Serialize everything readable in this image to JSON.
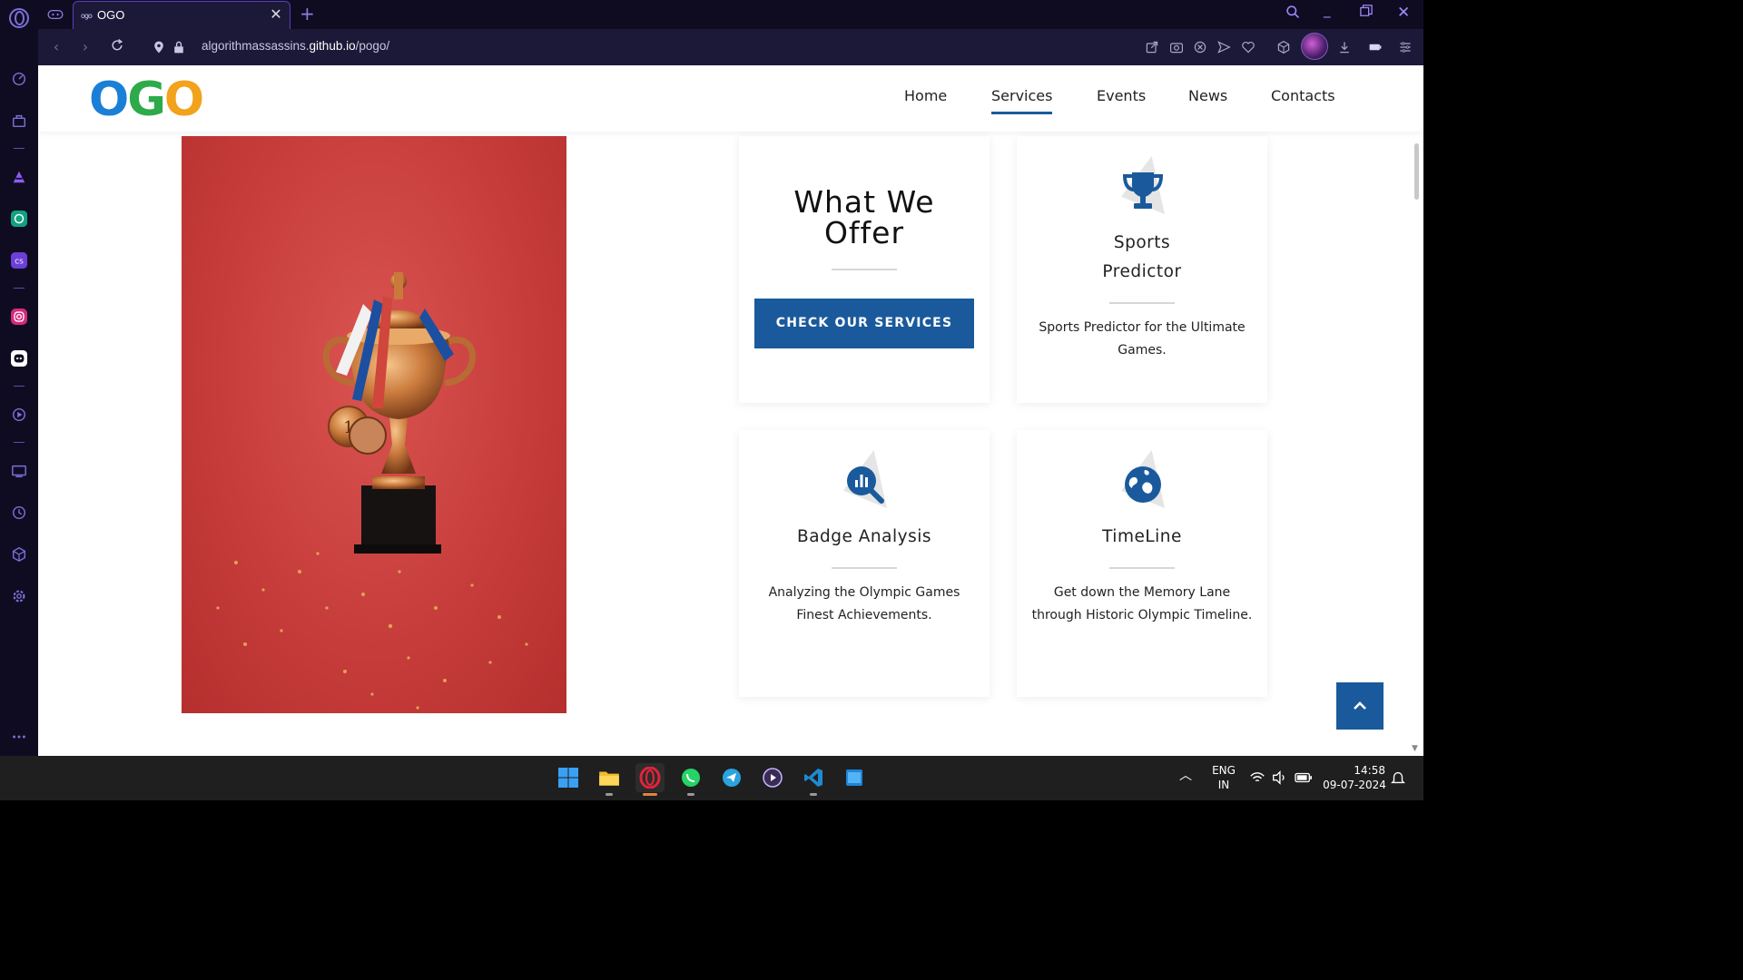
{
  "browser": {
    "tab_title": "OGO",
    "tab_favicon": "ogo",
    "url_prefix": "algorithmassassins.",
    "url_host": "github.io",
    "url_path": "/pogo/"
  },
  "site": {
    "logo": {
      "o1": "O",
      "g": "G",
      "o2": "O"
    },
    "nav": [
      {
        "label": "Home"
      },
      {
        "label": "Services"
      },
      {
        "label": "Events"
      },
      {
        "label": "News"
      },
      {
        "label": "Contacts"
      }
    ],
    "active_nav": "Services",
    "offer": {
      "title": "What We Offer",
      "cta": "CHECK OUR SERVICES"
    },
    "cards": [
      {
        "icon": "trophy-icon",
        "title": "Sports Predictor",
        "text": "Sports Predictor for the Ultimate Games."
      },
      {
        "icon": "chart-search-icon",
        "title": "Badge Analysis",
        "text": "Analyzing the Olympic Games Finest Achievements."
      },
      {
        "icon": "globe-icon",
        "title": "TimeLine",
        "text": "Get down the Memory Lane through Historic Olympic Timeline."
      }
    ]
  },
  "taskbar": {
    "lang_top": "ENG",
    "lang_bottom": "IN",
    "time": "14:58",
    "date": "09-07-2024"
  },
  "colors": {
    "brand_blue": "#1a5a9c",
    "opera_accent": "#a58cff",
    "hero_red": "#c73d3b"
  }
}
